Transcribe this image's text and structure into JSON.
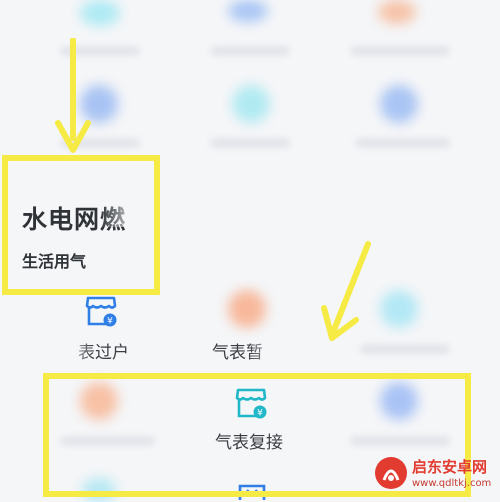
{
  "section": {
    "title": "水电网燃",
    "subtitle": "生活用气"
  },
  "items": [
    {
      "label": "表过户",
      "icon": "shop-meter-icon"
    },
    {
      "label": "气表暂",
      "icon": "blurred-orange-icon"
    },
    {
      "label": "气表复接",
      "icon": "shop-meter-icon"
    }
  ],
  "watermark": {
    "brand": "启东安卓网",
    "url": "www.qdltkj.com"
  },
  "colors": {
    "highlight": "#f6ea45",
    "icon_blue": "#2f7fe6",
    "watermark_red": "#e23b2f"
  }
}
